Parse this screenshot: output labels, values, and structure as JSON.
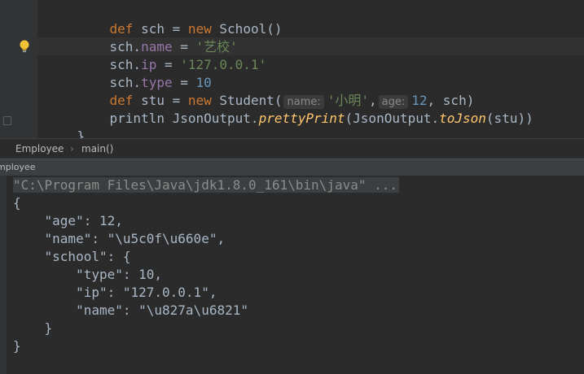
{
  "editor": {
    "lines": [
      {
        "kw": "def",
        "rest1": " sch = ",
        "kw2": "new",
        "rest2": " School()"
      },
      {
        "obj": "sch.",
        "field": "name",
        "eq": " = ",
        "str": "'艺校'"
      },
      {
        "obj": "sch.",
        "field": "ip",
        "eq": " = ",
        "str": "'127.0.0.1'"
      },
      {
        "obj": "sch.",
        "field": "type",
        "eq": " = ",
        "num": "10"
      }
    ],
    "stu_line": {
      "kw": "def",
      "rest1": " stu = ",
      "kw2": "new",
      "rest2": " Student(",
      "hint_name": "name:",
      "str": "'小明'",
      "comma1": ",",
      "hint_age": "age:",
      "num": "12",
      "rest3": ", sch)"
    },
    "print_line": {
      "plain1": "println JsonOutput.",
      "m1": "prettyPrint",
      "plain2": "(JsonOutput.",
      "m2": "toJson",
      "plain3": "(stu))"
    },
    "close_brace": "}"
  },
  "breadcrumb": {
    "class": "Employee",
    "sep": "›",
    "method": "main()"
  },
  "run_panel": {
    "tab_label": "mployee",
    "command": "\"C:\\Program Files\\Java\\jdk1.8.0_161\\bin\\java\" ...",
    "output": [
      "{",
      "    \"age\": 12,",
      "    \"name\": \"\\u5c0f\\u660e\",",
      "    \"school\": {",
      "        \"type\": 10,",
      "        \"ip\": \"127.0.0.1\",",
      "        \"name\": \"\\u827a\\u6821\"",
      "    }",
      "}"
    ]
  },
  "icons": {
    "bulb": "lightbulb-icon"
  }
}
